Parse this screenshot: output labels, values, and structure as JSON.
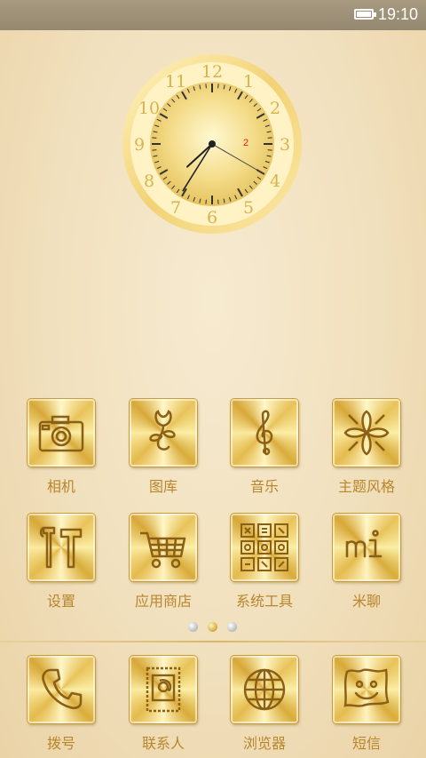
{
  "status_bar": {
    "time": "19:10",
    "icons": [
      "battery-icon"
    ]
  },
  "clock_widget": {
    "numerals": [
      "12",
      "1",
      "2",
      "3",
      "4",
      "5",
      "6",
      "7",
      "8",
      "9",
      "10",
      "11"
    ],
    "date_number": "2",
    "hour": 7,
    "minute": 35,
    "second": 20
  },
  "apps": [
    {
      "label": "相机",
      "icon": "camera-icon"
    },
    {
      "label": "图库",
      "icon": "flower-gallery-icon"
    },
    {
      "label": "音乐",
      "icon": "treble-clef-icon"
    },
    {
      "label": "主题风格",
      "icon": "theme-pattern-icon"
    },
    {
      "label": "设置",
      "icon": "tools-icon"
    },
    {
      "label": "应用商店",
      "icon": "shopping-cart-icon"
    },
    {
      "label": "系统工具",
      "icon": "tools-grid-icon"
    },
    {
      "label": "米聊",
      "icon": "mi-chat-icon"
    }
  ],
  "page_indicator": {
    "count": 3,
    "active": 1
  },
  "dock": [
    {
      "label": "拨号",
      "icon": "phone-icon"
    },
    {
      "label": "联系人",
      "icon": "contacts-stamp-icon"
    },
    {
      "label": "浏览器",
      "icon": "globe-icon"
    },
    {
      "label": "短信",
      "icon": "smiley-message-icon"
    }
  ],
  "colors": {
    "label": "#b8862c",
    "gold": "#d4a83c",
    "status_bar": "#9d9078"
  }
}
